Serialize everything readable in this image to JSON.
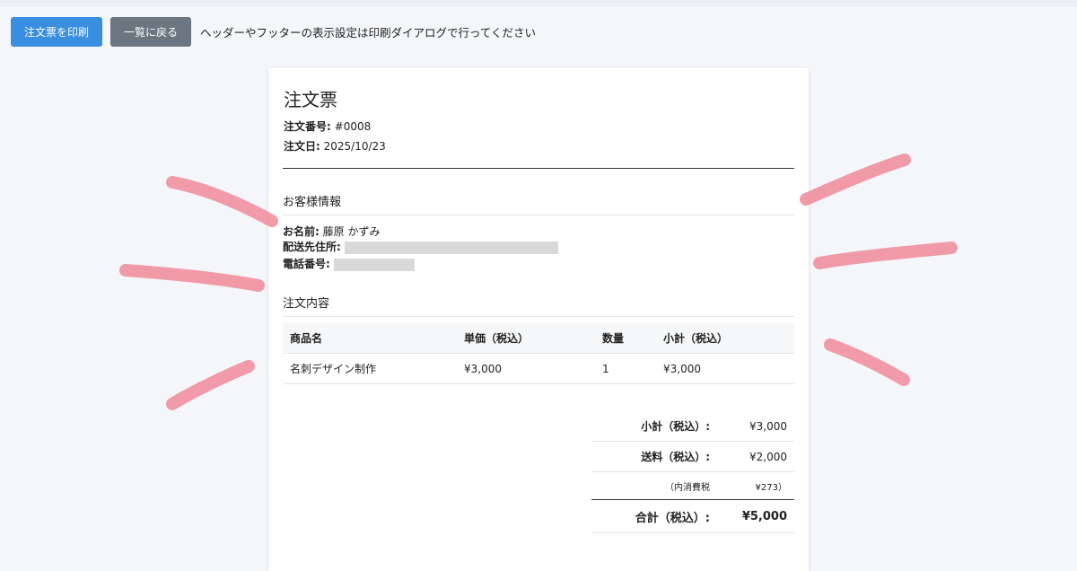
{
  "toolbar": {
    "print_label": "注文票を印刷",
    "back_label": "一覧に戻る",
    "note": "ヘッダーやフッターの表示設定は印刷ダイアログで行ってください"
  },
  "order": {
    "title": "注文票",
    "number_label": "注文番号:",
    "number": "#0008",
    "date_label": "注文日:",
    "date": "2025/10/23"
  },
  "customer": {
    "heading": "お客様情報",
    "name_label": "お名前:",
    "name": "藤原 かずみ",
    "address_label": "配送先住所:",
    "phone_label": "電話番号:"
  },
  "items": {
    "heading": "注文内容",
    "columns": [
      "商品名",
      "単価（税込）",
      "数量",
      "小計（税込）"
    ],
    "rows": [
      {
        "name": "名刺デザイン制作",
        "price": "¥3,000",
        "qty": "1",
        "subtotal": "¥3,000"
      }
    ]
  },
  "totals": {
    "subtotal_label": "小計（税込）:",
    "subtotal": "¥3,000",
    "shipping_label": "送料（税込）:",
    "shipping": "¥2,000",
    "tax_label": "（内消費税",
    "tax": "¥273）",
    "grand_label": "合計（税込）:",
    "grand": "¥5,000"
  },
  "colors": {
    "print_button": "#3a8ee0",
    "back_button": "#6b7680",
    "highlight_marks": "#f08a9a"
  }
}
